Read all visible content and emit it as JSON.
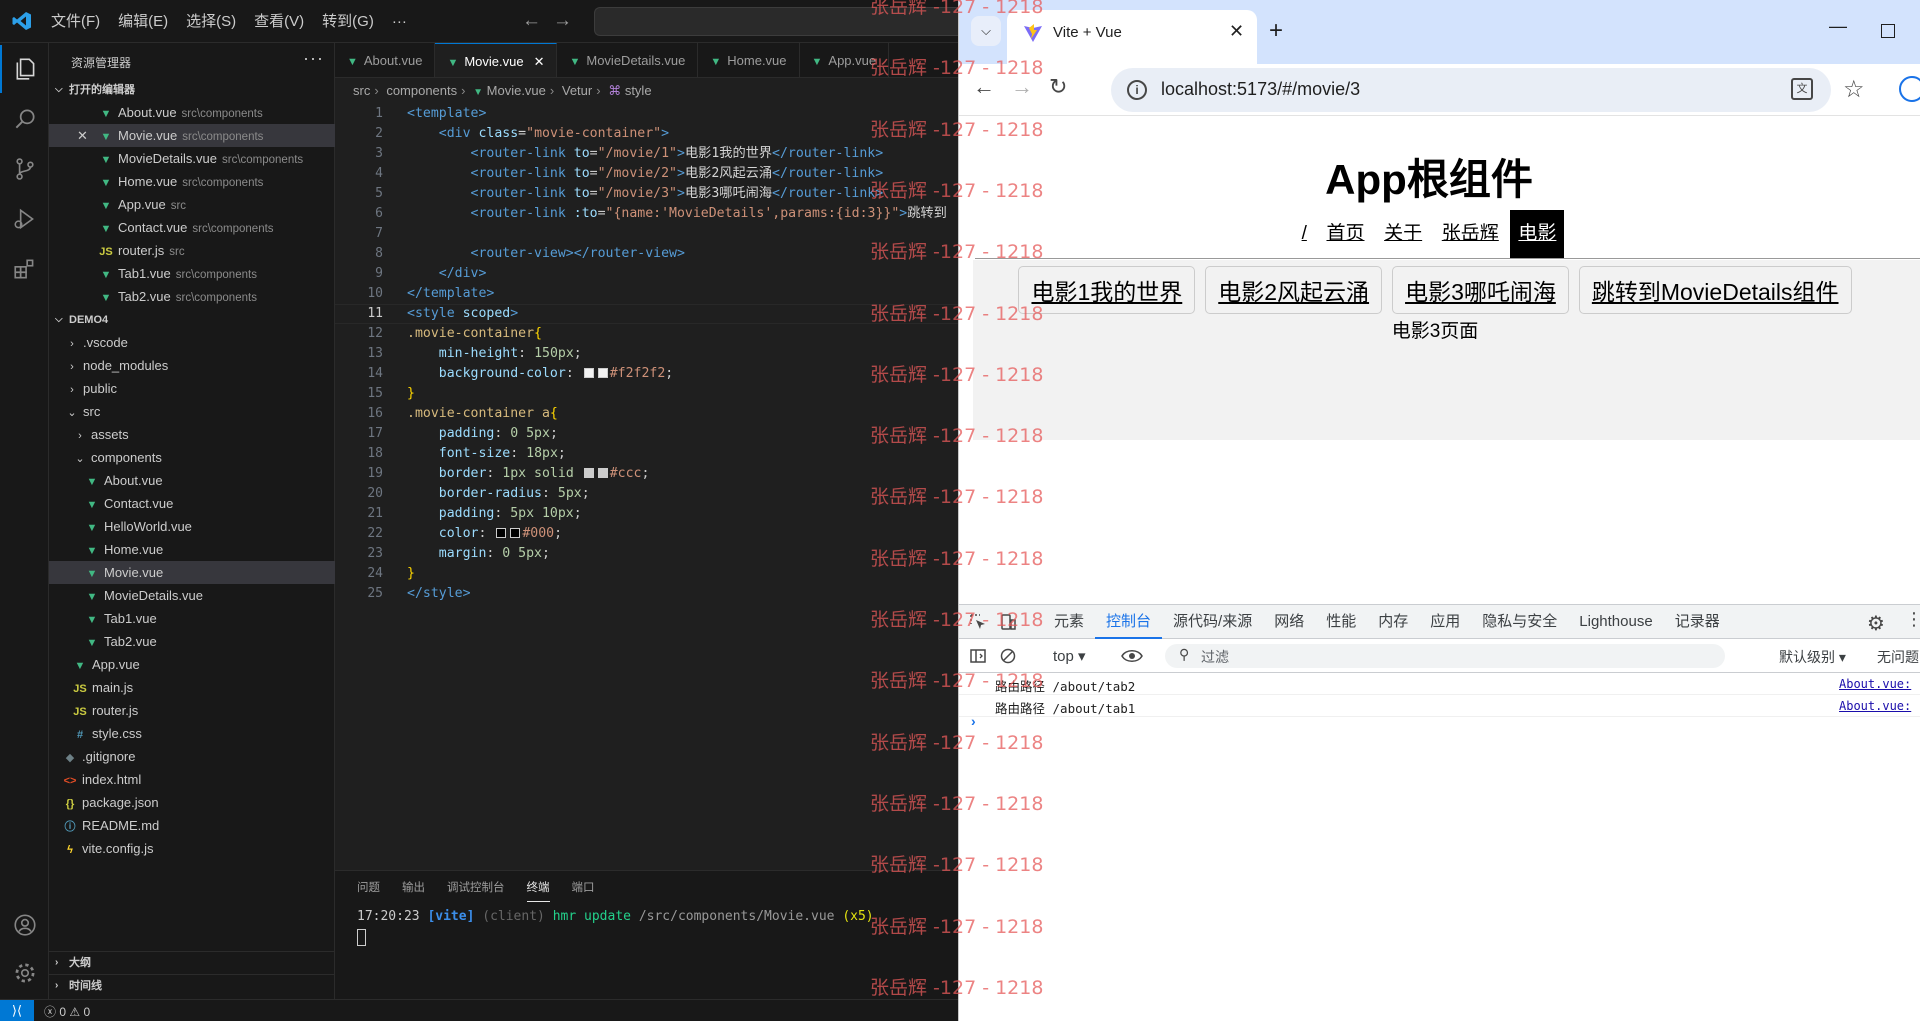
{
  "vscode": {
    "menu": [
      "文件(F)",
      "编辑(E)",
      "选择(S)",
      "查看(V)",
      "转到(G)",
      "···"
    ],
    "sidebar_title": "资源管理器",
    "open_editors_title": "打开的编辑器",
    "open_editors": [
      {
        "name": "About.vue",
        "path": "src\\components"
      },
      {
        "name": "Movie.vue",
        "path": "src\\components"
      },
      {
        "name": "MovieDetails.vue",
        "path": "src\\components"
      },
      {
        "name": "Home.vue",
        "path": "src\\components"
      },
      {
        "name": "App.vue",
        "path": "src"
      },
      {
        "name": "Contact.vue",
        "path": "src\\components"
      },
      {
        "name": "router.js",
        "path": "src"
      },
      {
        "name": "Tab1.vue",
        "path": "src\\components"
      },
      {
        "name": "Tab2.vue",
        "path": "src\\components"
      }
    ],
    "project_title": "DEMO4",
    "tree": [
      {
        "name": ".vscode"
      },
      {
        "name": "node_modules"
      },
      {
        "name": "public"
      },
      {
        "name": "src"
      },
      {
        "name": "assets"
      },
      {
        "name": "components"
      },
      {
        "name": "About.vue"
      },
      {
        "name": "Contact.vue"
      },
      {
        "name": "HelloWorld.vue"
      },
      {
        "name": "Home.vue"
      },
      {
        "name": "Movie.vue"
      },
      {
        "name": "MovieDetails.vue"
      },
      {
        "name": "Tab1.vue"
      },
      {
        "name": "Tab2.vue"
      },
      {
        "name": "App.vue"
      },
      {
        "name": "main.js"
      },
      {
        "name": "router.js"
      },
      {
        "name": "style.css"
      },
      {
        "name": ".gitignore"
      },
      {
        "name": "index.html"
      },
      {
        "name": "package.json"
      },
      {
        "name": "README.md"
      },
      {
        "name": "vite.config.js"
      }
    ],
    "outline_title": "大纲",
    "timeline_title": "时间线",
    "tabs": [
      "About.vue",
      "Movie.vue",
      "MovieDetails.vue",
      "Home.vue",
      "App.vue"
    ],
    "breadcrumb": [
      "src",
      "components",
      "Movie.vue",
      "Vetur",
      "style"
    ],
    "line_numbers": [
      "1",
      "2",
      "3",
      "4",
      "5",
      "6",
      "7",
      "8",
      "9",
      "10",
      "11",
      "12",
      "13",
      "14",
      "15",
      "16",
      "17",
      "18",
      "19",
      "20",
      "21",
      "22",
      "23",
      "24",
      "25"
    ],
    "code": {
      "l1": "<template>",
      "l2_a": "<div ",
      "l2_attr": "class",
      "l2_eq": "=",
      "l2_str": "\"movie-container\"",
      "l2_b": ">",
      "l3_a": "<router-link ",
      "l3_attr": "to",
      "l3_str": "\"/movie/1\"",
      "l3_text": "电影1我的世界",
      "l3_close": "</router-link>",
      "l4_a": "<router-link ",
      "l4_attr": "to",
      "l4_str": "\"/movie/2\"",
      "l4_text": "电影2风起云涌",
      "l4_close": "</router-link>",
      "l5_a": "<router-link ",
      "l5_attr": "to",
      "l5_str": "\"/movie/3\"",
      "l5_text": "电影3哪吒闹海",
      "l5_close": "</router-link>",
      "l6_a": "<router-link ",
      "l6_attr": ":to",
      "l6_str": "\"{name:'MovieDetails',params:{id:3}}\"",
      "l6_text": "跳转到",
      "l8_a": "<router-view>",
      "l8_b": "</router-view>",
      "l9": "</div>",
      "l10": "</template>",
      "l11_a": "<style ",
      "l11_attr": "scoped",
      "l11_b": ">",
      "l12_sel": ".movie-container",
      "l13_p": "min-height",
      "l13_v": "150px",
      "l14_p": "background-color",
      "l14_v": "#f2f2f2",
      "l16_sel": ".movie-container a",
      "l17_p": "padding",
      "l17_v": "0 5px",
      "l18_p": "font-size",
      "l18_v": "18px",
      "l19_p": "border",
      "l19_v1": "1px solid",
      "l19_v2": "#ccc",
      "l20_p": "border-radius",
      "l20_v": "5px",
      "l21_p": "padding",
      "l21_v": "5px 10px",
      "l22_p": "color",
      "l22_v": "#000",
      "l23_p": "margin",
      "l23_v": "0 5px",
      "l25": "</style>"
    },
    "panel_tabs": [
      "问题",
      "输出",
      "调试控制台",
      "终端",
      "端口"
    ],
    "terminal": {
      "time": "17:20:23",
      "tag": "[vite]",
      "client": "(client)",
      "msg": "hmr update",
      "path": "/src/components/Movie.vue",
      "count": "(x5)"
    },
    "status": {
      "errors": "0",
      "warnings": "0"
    }
  },
  "browser": {
    "tab_title": "Vite + Vue",
    "url": "localhost:5173/#/movie/3",
    "page": {
      "title": "App根组件",
      "nav": [
        "/",
        "首页",
        "关于",
        "张岳辉",
        "电影"
      ],
      "movie_links": [
        "电影1我的世界",
        "电影2风起云涌",
        "电影3哪吒闹海",
        "跳转到MovieDetails组件"
      ],
      "content": "电影3页面"
    },
    "devtools": {
      "tabs": [
        "元素",
        "控制台",
        "源代码/来源",
        "网络",
        "性能",
        "内存",
        "应用",
        "隐私与安全",
        "Lighthouse",
        "记录器"
      ],
      "context": "top ▾",
      "filter_placeholder": "过滤",
      "level": "默认级别 ▾",
      "issues": "无问题",
      "logs": [
        {
          "msg": "路由路径 /about/tab2",
          "src": "About.vue:"
        },
        {
          "msg": "路由路径 /about/tab1",
          "src": "About.vue:"
        }
      ]
    }
  },
  "watermark": "张岳辉 -127 - 1218",
  "colors": {
    "accent": "#0078d4",
    "vue": "#41b883",
    "chrome_blue": "#1a73e8"
  }
}
